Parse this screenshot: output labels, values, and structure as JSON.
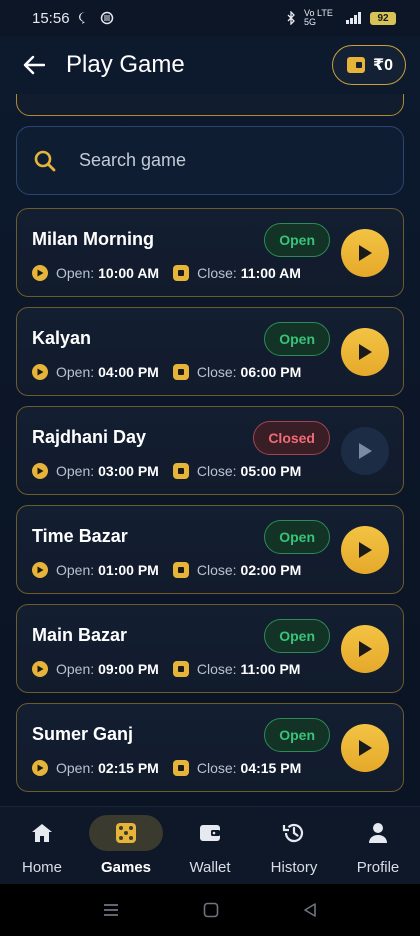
{
  "status_bar": {
    "time": "15:56",
    "network": "Vo LTE 5G",
    "battery": "92"
  },
  "header": {
    "title": "Play Game",
    "wallet_amount": "₹0"
  },
  "search": {
    "placeholder": "Search game"
  },
  "labels": {
    "open": "Open:",
    "close": "Close:"
  },
  "games": [
    {
      "name": "Milan Morning",
      "status": "Open",
      "open_time": "10:00 AM",
      "close_time": "11:00 AM"
    },
    {
      "name": "Kalyan",
      "status": "Open",
      "open_time": "04:00 PM",
      "close_time": "06:00 PM"
    },
    {
      "name": "Rajdhani Day",
      "status": "Closed",
      "open_time": "03:00 PM",
      "close_time": "05:00 PM"
    },
    {
      "name": "Time Bazar",
      "status": "Open",
      "open_time": "01:00 PM",
      "close_time": "02:00 PM"
    },
    {
      "name": "Main Bazar",
      "status": "Open",
      "open_time": "09:00 PM",
      "close_time": "11:00 PM"
    },
    {
      "name": "Sumer Ganj",
      "status": "Open",
      "open_time": "02:15 PM",
      "close_time": "04:15 PM"
    }
  ],
  "nav": [
    {
      "label": "Home",
      "icon": "home-icon"
    },
    {
      "label": "Games",
      "icon": "dice-icon",
      "active": true
    },
    {
      "label": "Wallet",
      "icon": "wallet-icon"
    },
    {
      "label": "History",
      "icon": "history-icon"
    },
    {
      "label": "Profile",
      "icon": "profile-icon"
    }
  ],
  "colors": {
    "accent": "#e7b43a",
    "open_status": "#39c37a",
    "closed_status": "#f06b76",
    "background": "#0b1424"
  }
}
